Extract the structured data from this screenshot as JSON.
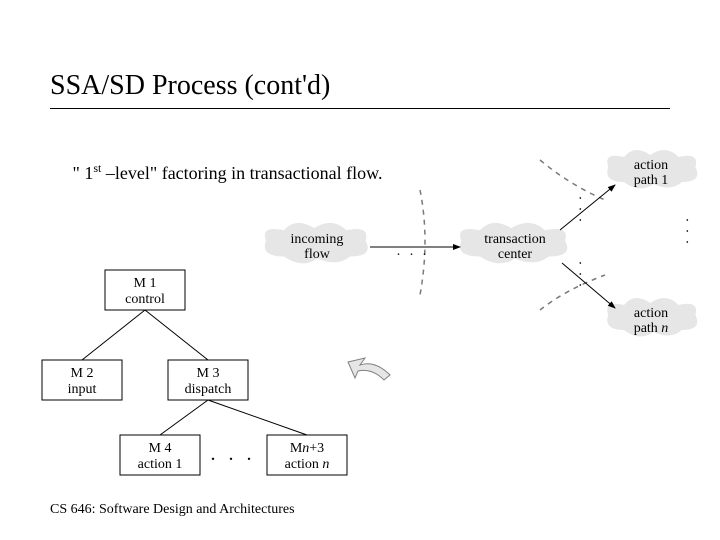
{
  "title": "SSA/SD Process (cont'd)",
  "subtitle_prefix": " \" 1",
  "subtitle_super": "st",
  "subtitle_suffix": " –level\" factoring in transactional flow.",
  "footer": "CS 646: Software Design and Architectures",
  "modules": {
    "m1_line1": "M 1",
    "m1_line2": "control",
    "m2_line1": "M 2",
    "m2_line2": "input",
    "m3_line1": "M 3",
    "m3_line2": "dispatch",
    "m4_line1": "M 4",
    "m4_line2": "action 1",
    "mn_line1_a": "M",
    "mn_line1_b": "n",
    "mn_line1_c": "+3",
    "mn_line2_a": "action ",
    "mn_line2_b": "n"
  },
  "clouds": {
    "incoming_line1": "incoming",
    "incoming_line2": "flow",
    "tc_line1": "transaction",
    "tc_line2": "center",
    "ap1_line1": "action",
    "ap1_line2": "path 1",
    "apn_line1": "action",
    "apn_line2_a": "path ",
    "apn_line2_b": "n"
  },
  "ellipsis": ". . .",
  "flow_dots": ". . ."
}
